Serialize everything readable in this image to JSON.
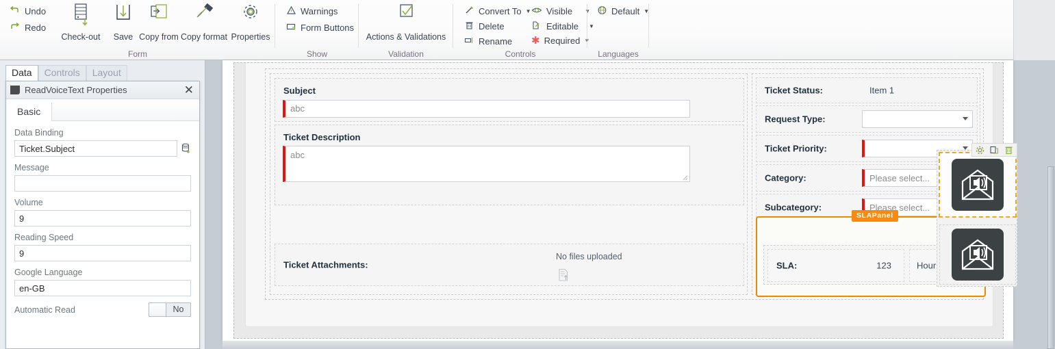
{
  "ribbon": {
    "groups": [
      {
        "name": "Form",
        "label": "Form",
        "small_items": [
          {
            "label": "Undo",
            "icon": "undo-icon"
          },
          {
            "label": "Redo",
            "icon": "redo-icon"
          }
        ],
        "big_items": [
          {
            "label": "Check-out",
            "icon": "check-out-icon"
          },
          {
            "label": "Save",
            "icon": "save-icon"
          },
          {
            "label": "Copy from",
            "icon": "copy-from-icon"
          },
          {
            "label": "Copy format",
            "icon": "copy-format-icon"
          },
          {
            "label": "Properties",
            "icon": "gear-icon"
          }
        ]
      },
      {
        "name": "Show",
        "label": "Show",
        "small_items": [
          {
            "label": "Warnings",
            "icon": "warning-triangle-icon"
          },
          {
            "label": "Form Buttons",
            "icon": "form-buttons-icon"
          }
        ]
      },
      {
        "name": "Validation",
        "label": "Validation",
        "big_items": [
          {
            "label": "Actions & Validations",
            "icon": "checkmark-box-icon"
          }
        ]
      },
      {
        "name": "Controls",
        "label": "Controls",
        "small_items": [
          {
            "label": "Convert To",
            "icon": "magic-wand-icon",
            "has_caret": true
          },
          {
            "label": "Delete",
            "icon": "trash-icon",
            "has_caret": false
          },
          {
            "label": "Rename",
            "icon": "rename-icon",
            "has_caret": false
          },
          {
            "label": "Visible",
            "icon": "eye-icon",
            "has_caret": true
          },
          {
            "label": "Editable",
            "icon": "pencil-page-icon",
            "has_caret": true
          },
          {
            "label": "Required",
            "icon": "asterisk-icon",
            "has_caret": true
          }
        ]
      },
      {
        "name": "Languages",
        "label": "Languages",
        "small_items": [
          {
            "label": "Default",
            "icon": "globe-icon",
            "has_caret": true
          }
        ]
      }
    ]
  },
  "left_panel": {
    "tabs": [
      {
        "label": "Data",
        "active": true
      },
      {
        "label": "Controls",
        "active": false
      },
      {
        "label": "Layout",
        "active": false
      }
    ],
    "properties_window": {
      "title": "ReadVoiceText Properties",
      "close_label": "✕",
      "inner_tabs": [
        {
          "label": "Basic",
          "active": true
        }
      ],
      "fields": [
        {
          "label": "Data Binding",
          "value": "Ticket.Subject",
          "placeholder": "",
          "has_picker": true
        },
        {
          "label": "Message",
          "value": "",
          "placeholder": "",
          "has_picker": false
        },
        {
          "label": "Volume",
          "value": "9",
          "placeholder": "",
          "has_picker": false
        },
        {
          "label": "Reading Speed",
          "value": "9",
          "placeholder": "",
          "has_picker": false
        },
        {
          "label": "Google Language",
          "value": "en-GB",
          "placeholder": "",
          "has_picker": false
        }
      ],
      "toggle": {
        "label": "Automatic Read",
        "value": "No"
      }
    }
  },
  "form_canvas": {
    "left_column": {
      "subject": {
        "label": "Subject",
        "value": "abc"
      },
      "description": {
        "label": "Ticket Description",
        "value": "abc"
      },
      "attachments": {
        "label": "Ticket Attachments:",
        "status": "No files uploaded",
        "icon": "upload-file-icon"
      }
    },
    "media_column": {
      "selected_tile": {
        "icon": "envelope-speaker-icon",
        "selected": true
      },
      "second_tile": {
        "icon": "envelope-speaker-icon",
        "selected": false
      },
      "toolbar": [
        {
          "label": "Settings",
          "icon": "gear-icon"
        },
        {
          "label": "Duplicate",
          "icon": "duplicate-icon"
        },
        {
          "label": "Delete",
          "icon": "trash-icon"
        }
      ]
    },
    "right_column": {
      "rows": [
        {
          "label": "Ticket Status:",
          "kind": "text",
          "value": "Item 1"
        },
        {
          "label": "Request Type:",
          "kind": "dropdown",
          "value": "",
          "required": false
        },
        {
          "label": "Ticket Priority:",
          "kind": "dropdown",
          "value": "",
          "required": true
        },
        {
          "label": "Category:",
          "kind": "dropdown",
          "value": "Please select...",
          "required": true
        },
        {
          "label": "Subcategory:",
          "kind": "dropdown",
          "value": "Please select...",
          "required": true
        }
      ],
      "sla_panel": {
        "tag": "SLAPanel",
        "label": "SLA:",
        "value": "123",
        "unit": "Hour(s)"
      }
    }
  },
  "colors": {
    "accent_orange": "#f78b11",
    "panel_border_orange": "#e88b00",
    "required_red": "#e8120f",
    "ribbon_group_label": "#7b6f84",
    "label_dark": "#22313f",
    "selection_dashes": "#f0a91e"
  }
}
